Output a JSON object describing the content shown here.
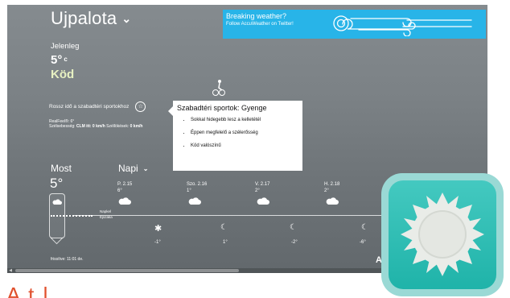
{
  "location": {
    "city": "Ujpalota"
  },
  "current": {
    "label": "Jelenleg",
    "temp": "5°",
    "temp_unit": "c",
    "condition": "Köd",
    "sport_line": "Rossz idő a szabadtéri sportokhoz",
    "realfeel": "RealFeel®: 6°",
    "details_prefix": "Szélsebesség:",
    "wind_speed": "CLM itt: 0 km/h",
    "gust_label": "Széllökések:",
    "gust": "0 km/h"
  },
  "ad": {
    "line1": "Breaking weather?",
    "line2": "Follow AccuWeather on Twitter!"
  },
  "popup": {
    "title": "Szabadtéri sportok: Gyenge",
    "items": [
      "Sokkal hidegebb lesz a kelletétél",
      "Éppen megfelelő a szélerősség",
      "Köd valószínű"
    ]
  },
  "forecast": {
    "now_label": "Most",
    "now_temp": "5°",
    "mode_label": "Napi",
    "napkelte": "Napkel",
    "napkelte2": "Éjszaka",
    "days": [
      {
        "label": "P. 2.15",
        "temp": "6°",
        "icon": "cloud-icon",
        "night_icon": "snowflake-icon",
        "night_temp": "-1°"
      },
      {
        "label": "Szo. 2.16",
        "temp": "1°",
        "icon": "cloud-icon",
        "night_icon": "moon-icon",
        "night_temp": "1°"
      },
      {
        "label": "V. 2.17",
        "temp": "2°",
        "icon": "cloud-icon",
        "night_icon": "moon-icon",
        "night_temp": "-2°"
      },
      {
        "label": "H. 2.18",
        "temp": "2°",
        "icon": "cloud-icon",
        "night_icon": "moon-icon",
        "night_temp": "-6°"
      }
    ],
    "updated": "frissítve: 11:01 de.",
    "brand_letter": "A"
  },
  "page": {
    "cropped_text": "A                      t l"
  },
  "colors": {
    "ad_bg": "#28b4e8",
    "condition_text": "#e7f1c2",
    "icon_teal": "#1fb3a9",
    "icon_sun": "#e9ece8",
    "cropped_text": "#e0502d"
  }
}
